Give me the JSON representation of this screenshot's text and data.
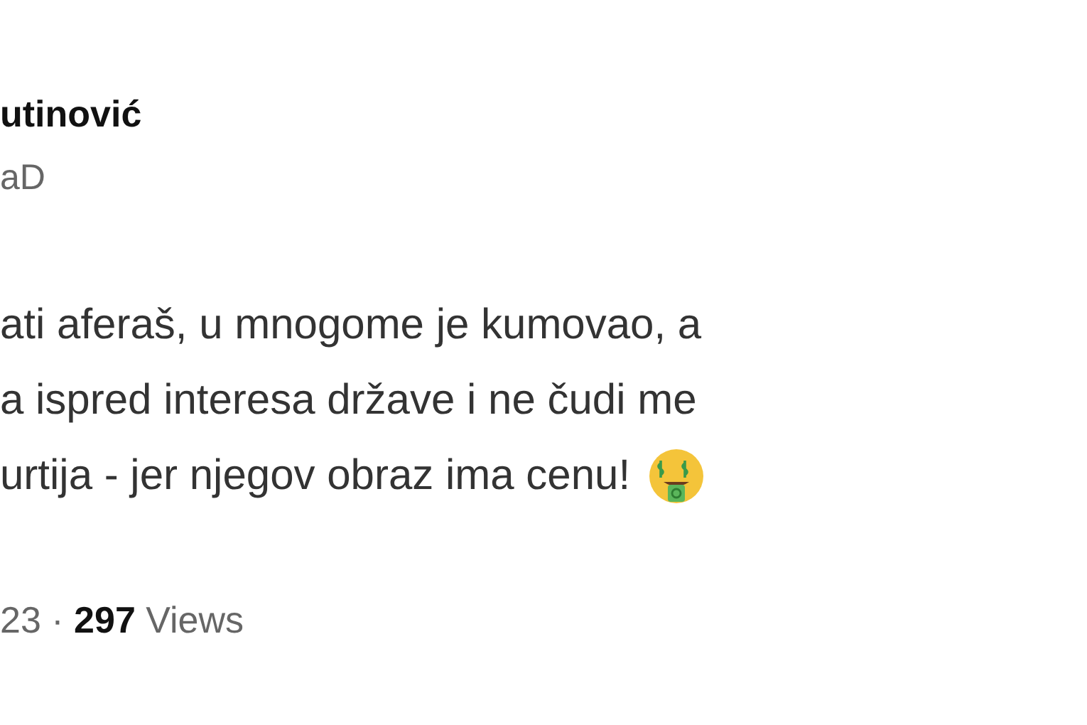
{
  "author": {
    "name": "utinović",
    "handle": "aD"
  },
  "tweet": {
    "lines": [
      "ati aferaš, u mnogome je kumovao, a",
      "a ispred interesa države i ne čudi me",
      "urtija - jer njegov obraz ima cenu!"
    ]
  },
  "meta": {
    "text": "23 · **297** Views"
  }
}
